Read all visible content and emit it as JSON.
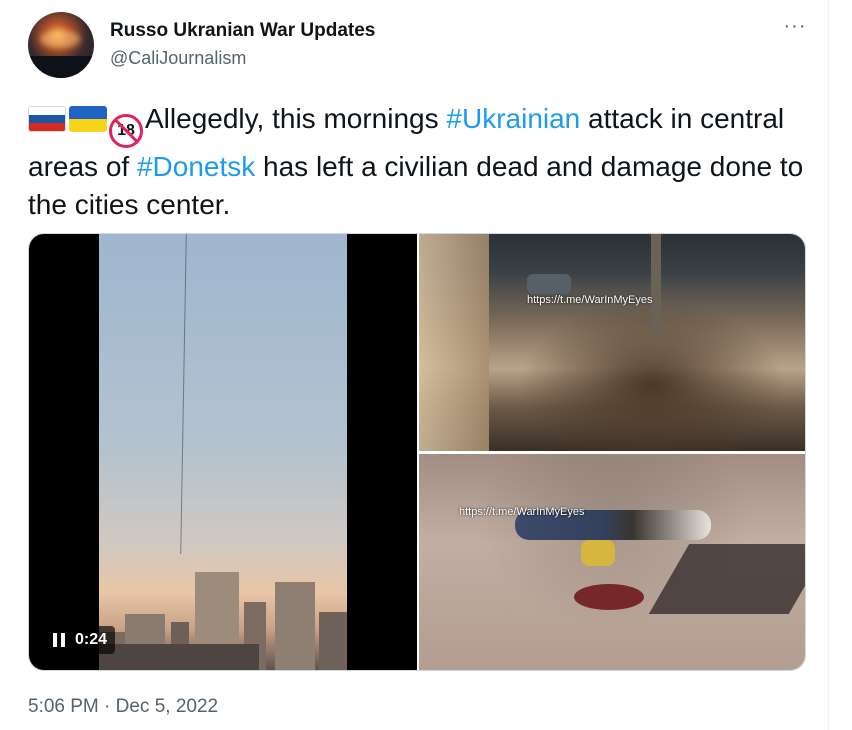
{
  "tweet": {
    "author_name": "Russo Ukranian War Updates",
    "author_handle": "@CaliJournalism",
    "more_glyph": "···",
    "text_part1": "Allegedly, this mornings ",
    "hashtag1": "#Ukrainian",
    "text_part2": " attack in central areas of ",
    "hashtag2": "#Donetsk",
    "text_part3": " has left a civilian dead and damage done to the cities center.",
    "badge_18": "18",
    "timestamp": "5:06 PM · Dec 5, 2022",
    "colors": {
      "link": "#1d9bf0",
      "text": "#0f1419",
      "secondary": "#536471"
    }
  },
  "media": {
    "video": {
      "duration": "0:24",
      "control_icon": "pause-icon"
    },
    "photos": [
      {
        "watermark": "https://t.me/WarInMyEyes"
      },
      {
        "watermark": "https://t.me/WarInMyEyes"
      }
    ]
  }
}
